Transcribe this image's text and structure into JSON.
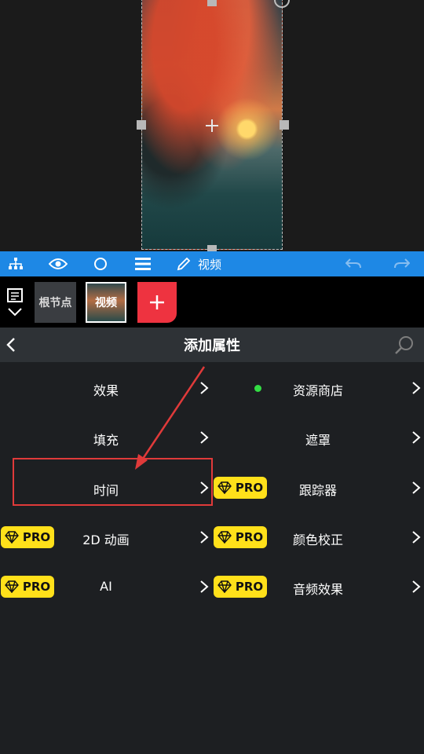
{
  "toolbar": {
    "icons": [
      "hierarchy-icon",
      "eye-icon",
      "circle-icon",
      "menu-icon",
      "pencil-icon",
      "undo-icon",
      "redo-icon"
    ],
    "label": "视频"
  },
  "layers": {
    "root_label": "根节点",
    "video_label": "视频"
  },
  "header": {
    "title": "添加属性"
  },
  "items": [
    {
      "label": "效果",
      "pro": false
    },
    {
      "label": "资源商店",
      "pro": false,
      "dot": true
    },
    {
      "label": "填充",
      "pro": false
    },
    {
      "label": "遮罩",
      "pro": false
    },
    {
      "label": "时间",
      "pro": false
    },
    {
      "label": "跟踪器",
      "pro": true
    },
    {
      "label": "2D 动画",
      "pro": true
    },
    {
      "label": "颜色校正",
      "pro": true
    },
    {
      "label": "AI",
      "pro": true
    },
    {
      "label": "音频效果",
      "pro": true
    }
  ],
  "pro_badge": "PRO",
  "colors": {
    "accent": "#1e88e5",
    "pro": "#ffe01a",
    "add": "#ee3340",
    "highlight": "#e03a3a",
    "store_dot": "#33dd44"
  }
}
